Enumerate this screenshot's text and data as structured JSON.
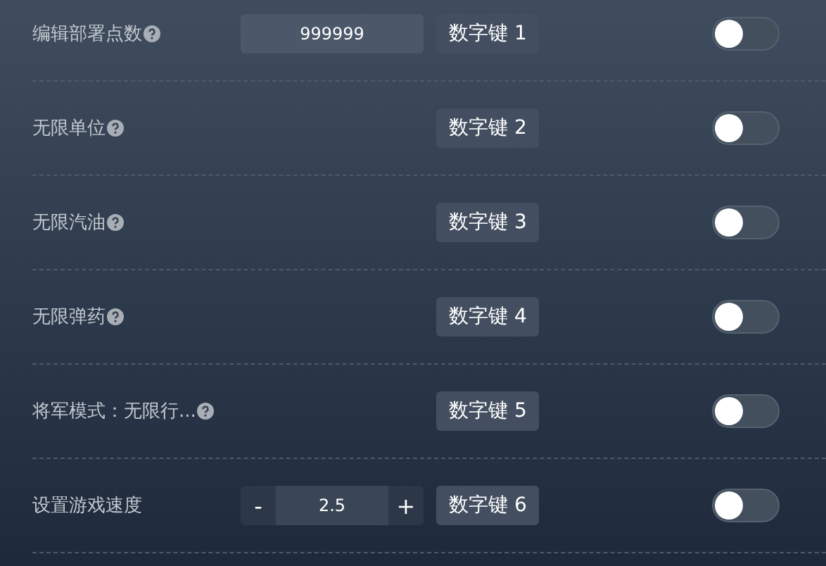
{
  "rows": [
    {
      "kind": "input",
      "label": "编辑部署点数",
      "help": true,
      "value": "999999",
      "hotkey": "数字键 1",
      "on": false
    },
    {
      "kind": "plain",
      "label": "无限单位",
      "help": true,
      "hotkey": "数字键 2",
      "on": false
    },
    {
      "kind": "plain",
      "label": "无限汽油",
      "help": true,
      "hotkey": "数字键 3",
      "on": false
    },
    {
      "kind": "plain",
      "label": "无限弹药",
      "help": true,
      "hotkey": "数字键 4",
      "on": false
    },
    {
      "kind": "plain",
      "label": "将军模式：无限行...",
      "help": true,
      "hotkey": "数字键 5",
      "on": false
    },
    {
      "kind": "stepper",
      "label": "设置游戏速度",
      "help": false,
      "minus": "-",
      "value": "2.5",
      "plus": "+",
      "hotkey": "数字键 6",
      "on": false
    }
  ]
}
